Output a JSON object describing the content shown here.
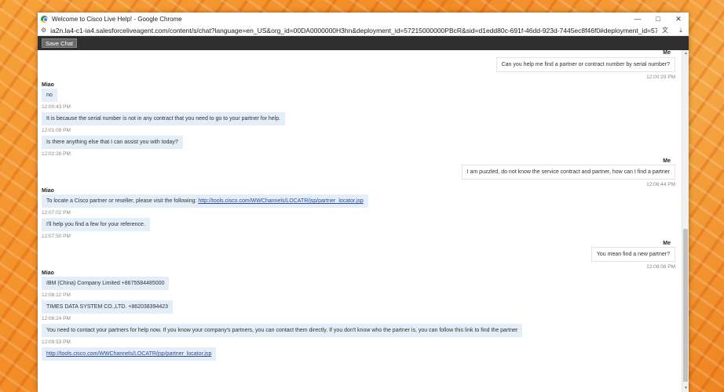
{
  "window": {
    "title": "Welcome to Cisco Live Help! - Google Chrome",
    "url": "ia2n.la4-c1-ia4.salesforceliveagent.com/content/s/chat?language=en_US&org_id=00DA0000000H3hn&deployment_id=57215000000PBcR&sid=d1edd80c-691f-46dd-923d-7445ec8f46f0#deployment_id=57215..."
  },
  "toolbar": {
    "save_label": "Save Chat"
  },
  "chat": {
    "messages": [
      {
        "sender": "Me",
        "text": "Can you help me find a partner or contract number by serial number?",
        "time": "12:00:29 PM"
      },
      {
        "sender": "Miao",
        "text": "no",
        "time": "12:00:43 PM"
      },
      {
        "sender": "",
        "text": "It is because the serial number is not in any contract that you need to go to your partner for help.",
        "time": "12:01:09 PM"
      },
      {
        "sender": "",
        "text": "Is there anything else that I can assist you with today?",
        "time": "12:02:26 PM"
      },
      {
        "sender": "Me",
        "text": "I am puzzled, do not know the service contract and partner, how can I find a partner",
        "time": "12:06:44 PM"
      },
      {
        "sender": "Miao",
        "text": "To locate a Cisco partner or reseller, please visit the following: ",
        "link": "http://tools.cisco.com/WWChannels/LOCATR/jsp/partner_locator.jsp",
        "time": "12:07:02 PM"
      },
      {
        "sender": "",
        "text": "I'll help you find a few for your reference.",
        "time": "12:07:50 PM"
      },
      {
        "sender": "Me",
        "text": "You mean find a new partner?",
        "time": "12:08:08 PM"
      },
      {
        "sender": "Miao",
        "text": "IBM (China) Company Limited  +8675584485000",
        "time": "12:08:12 PM"
      },
      {
        "sender": "",
        "text": "TIMES DATA SYSTEM CO.,LTD. +862038394423",
        "time": "12:08:24 PM"
      },
      {
        "sender": "",
        "text": "You need to contact your partners for help now. If you know your company's partners, you can contact them directly. If you don't know who the partner is, you can follow this link to find the partner",
        "time": "12:09:53 PM"
      },
      {
        "sender": "",
        "link": "http://tools.cisco.com/WWChannels/LOCATR/jsp/partner_locator.jsp"
      }
    ]
  }
}
